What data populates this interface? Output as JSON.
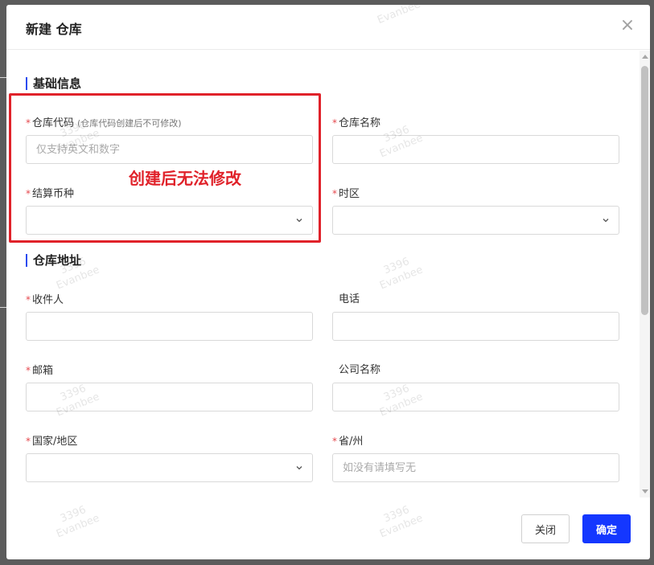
{
  "dialog": {
    "title": "新建 仓库",
    "close_icon": "close-icon"
  },
  "sections": {
    "basic_title": "基础信息",
    "address_title": "仓库地址"
  },
  "fields": {
    "warehouse_code": {
      "label": "仓库代码",
      "hint": "(仓库代码创建后不可修改)",
      "placeholder": "仅支持英文和数字",
      "value": "",
      "required": "*"
    },
    "warehouse_name": {
      "label": "仓库名称",
      "value": "",
      "required": "*"
    },
    "settlement_currency": {
      "label": "结算币种",
      "value": "",
      "required": "*"
    },
    "timezone": {
      "label": "时区",
      "value": "",
      "required": "*"
    },
    "recipient": {
      "label": "收件人",
      "value": "",
      "required": "*"
    },
    "phone": {
      "label": "电话",
      "value": ""
    },
    "email": {
      "label": "邮箱",
      "value": "",
      "required": "*"
    },
    "company_name": {
      "label": "公司名称",
      "value": ""
    },
    "country_region": {
      "label": "国家/地区",
      "value": "",
      "required": "*"
    },
    "province_state": {
      "label": "省/州",
      "placeholder": "如没有请填写无",
      "value": "",
      "required": "*"
    }
  },
  "annotation": {
    "text": "创建后无法修改",
    "color": "#e0222a"
  },
  "footer": {
    "close_label": "关闭",
    "confirm_label": "确定"
  },
  "watermark": {
    "number": "3396",
    "name": "Evanbee"
  },
  "colors": {
    "primary": "#1437ff",
    "section_bar": "#2b4bef",
    "required": "#e5484d"
  }
}
